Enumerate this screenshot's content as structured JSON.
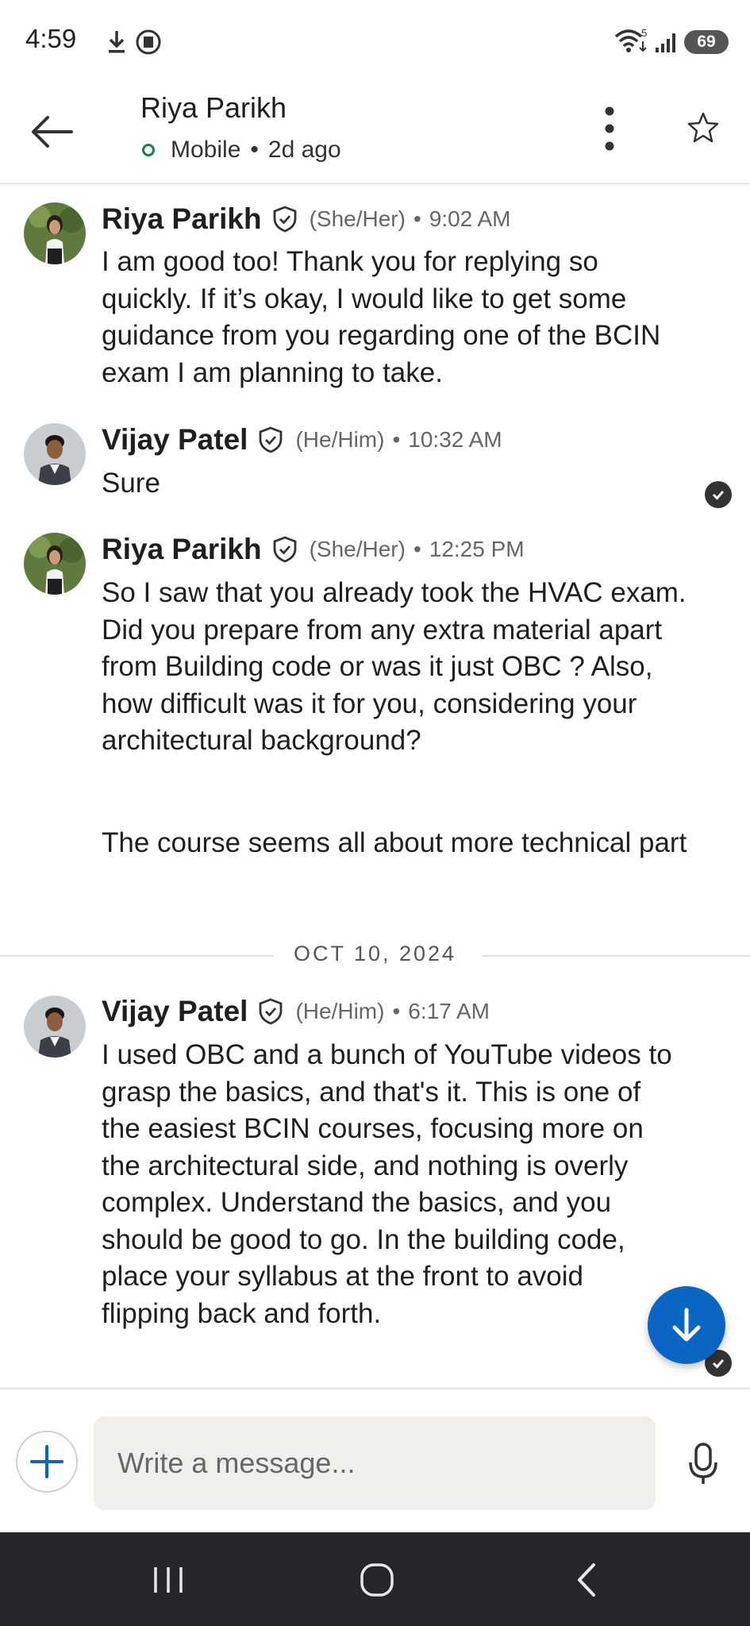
{
  "status_bar": {
    "time": "4:59",
    "battery": "69"
  },
  "header": {
    "contact_name": "Riya Parikh",
    "presence": "Mobile",
    "last_seen": "2d ago"
  },
  "messages": [
    {
      "sender": "Riya Parikh",
      "pronouns": "(She/Her)",
      "time": "9:02 AM",
      "text": "I am good too! Thank you for replying so quickly. If it’s okay, I would like to get some guidance from you regarding one of the BCIN exam I am planning to take."
    },
    {
      "sender": "Vijay Patel",
      "pronouns": "(He/Him)",
      "time": "10:32 AM",
      "text": "Sure"
    },
    {
      "sender": "Riya Parikh",
      "pronouns": "(She/Her)",
      "time": "12:25 PM",
      "text": "So I saw that you already took the HVAC exam. Did you prepare from any extra material apart from Building code or was it just OBC ? Also, how difficult was it for you, considering your architectural background?",
      "text2": "The course seems all about more technical part"
    },
    {
      "sender": "Vijay Patel",
      "pronouns": "(He/Him)",
      "time": "6:17 AM",
      "text": "I used OBC and a bunch of YouTube videos to grasp the basics, and that's it. This is one of the easiest BCIN courses, focusing more on the architectural side, and nothing is overly complex. Understand the basics, and you should be good to go. In the building code, place your syllabus at the front to avoid flipping back and forth."
    }
  ],
  "date_divider": "OCT 10, 2024",
  "composer": {
    "placeholder": "Write a message..."
  },
  "colors": {
    "accent": "#0a66c2",
    "presence": "#1a7f4b",
    "nav_bg": "#25262b"
  }
}
